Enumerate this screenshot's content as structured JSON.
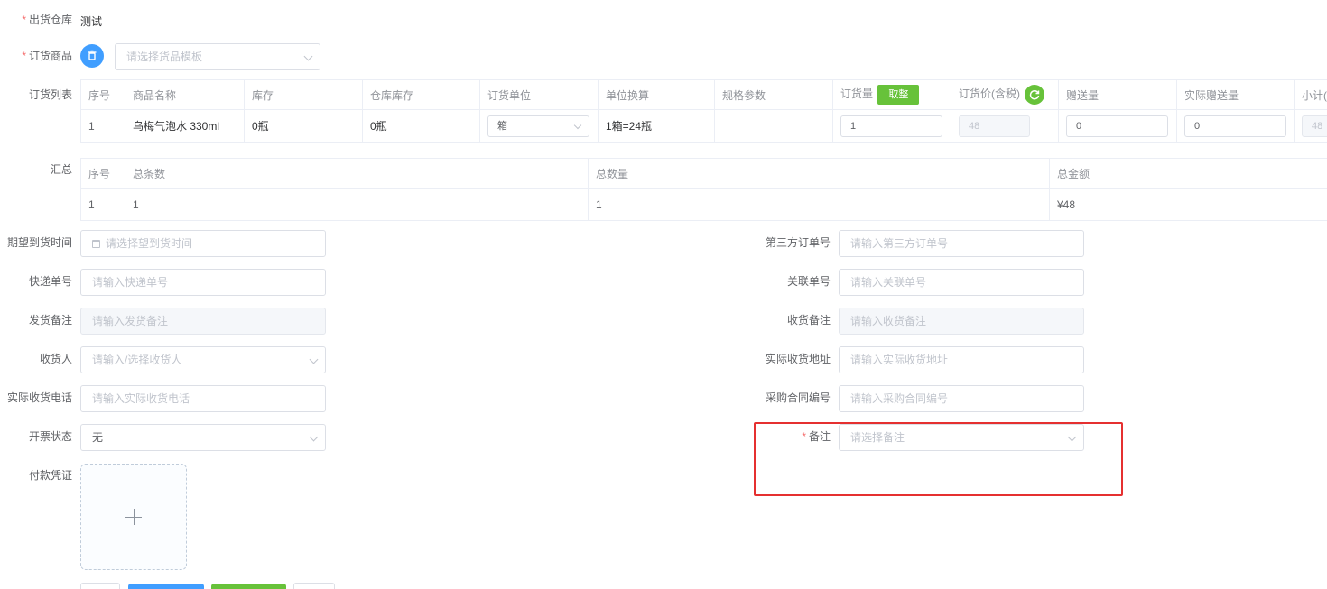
{
  "form": {
    "warehouse": {
      "label": "出货仓库",
      "value": "测试"
    },
    "goods": {
      "label": "订货商品",
      "template_placeholder": "请选择货品模板",
      "delete_icon": "trash-icon"
    },
    "order_list": {
      "label": "订货列表",
      "headers": [
        "序号",
        "商品名称",
        "库存",
        "仓库库存",
        "订货单位",
        "单位换算",
        "规格参数",
        "订货量",
        "订货价(含税)",
        "赠送量",
        "实际赠送量",
        "小计(含"
      ],
      "round_button": "取整",
      "refresh_icon": "refresh-icon",
      "row": {
        "index": "1",
        "name": "乌梅气泡水 330ml",
        "stock": "0瓶",
        "warehouse_stock": "0瓶",
        "unit": "箱",
        "conversion": "1箱=24瓶",
        "spec": "",
        "quantity": "1",
        "price": "48",
        "gift": "0",
        "actual_gift": "0",
        "subtotal": "48"
      }
    },
    "summary": {
      "label": "汇总",
      "headers": [
        "序号",
        "总条数",
        "总数量",
        "总金额"
      ],
      "row": [
        "1",
        "1",
        "1",
        "¥48"
      ]
    },
    "left_fields": [
      {
        "label": "期望到货时间",
        "placeholder": "请选择望到货时间",
        "kind": "date"
      },
      {
        "label": "快递单号",
        "placeholder": "请输入快递单号",
        "kind": "text"
      },
      {
        "label": "发货备注",
        "placeholder": "请输入发货备注",
        "kind": "disabled"
      },
      {
        "label": "收货人",
        "placeholder": "请输入/选择收货人",
        "kind": "select"
      },
      {
        "label": "实际收货电话",
        "placeholder": "请输入实际收货电话",
        "kind": "text"
      },
      {
        "label": "开票状态",
        "value": "无",
        "kind": "select-value"
      }
    ],
    "right_fields": [
      {
        "label": "第三方订单号",
        "placeholder": "请输入第三方订单号",
        "kind": "text"
      },
      {
        "label": "关联单号",
        "placeholder": "请输入关联单号",
        "kind": "text"
      },
      {
        "label": "收货备注",
        "placeholder": "请输入收货备注",
        "kind": "disabled"
      },
      {
        "label": "实际收货地址",
        "placeholder": "请输入实际收货地址",
        "kind": "text"
      },
      {
        "label": "采购合同编号",
        "placeholder": "请输入采购合同编号",
        "kind": "text"
      }
    ],
    "remark": {
      "label": "备注",
      "placeholder": "请选择备注"
    },
    "payment_proof": {
      "label": "付款凭证",
      "upload_icon": "plus-icon"
    }
  },
  "colors": {
    "primary": "#409eff",
    "success": "#67c23a",
    "danger": "#f56c6c",
    "highlight": "#e53030"
  }
}
